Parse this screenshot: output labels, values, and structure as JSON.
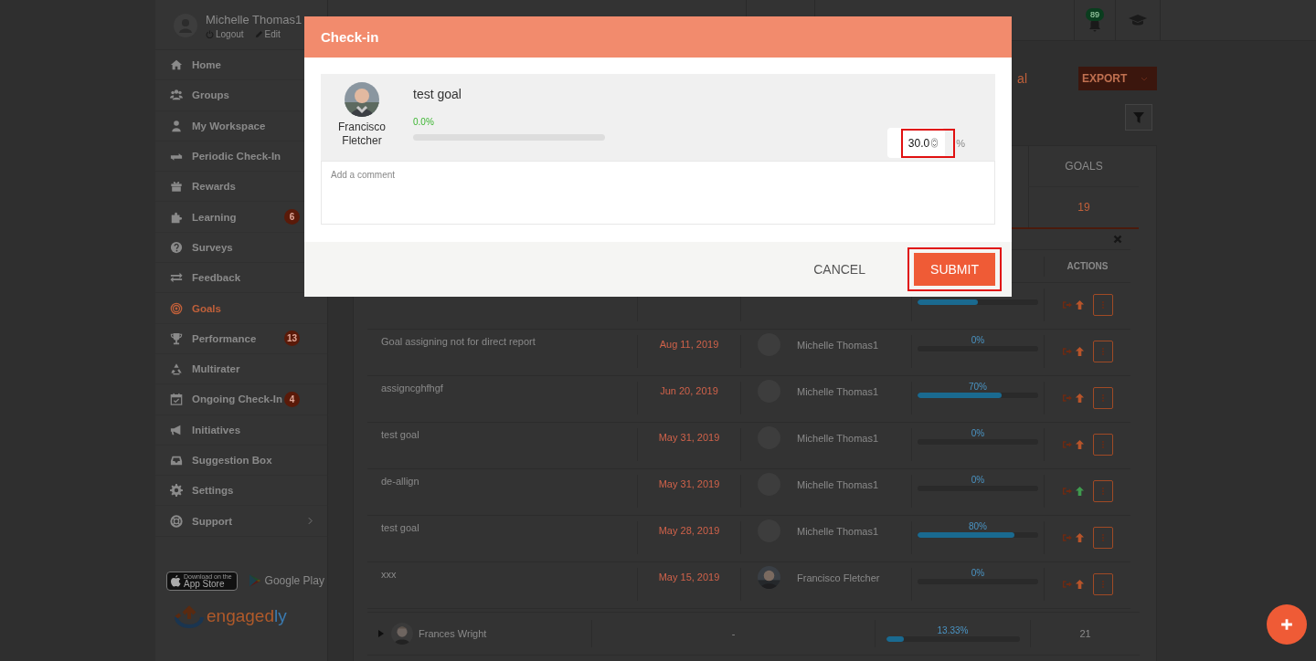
{
  "user": {
    "name": "Michelle Thomas1",
    "links": [
      {
        "label": "Logout",
        "kind": "logout"
      },
      {
        "label": "Edit",
        "kind": "edit"
      }
    ]
  },
  "notifications": {
    "badge": "89"
  },
  "sidebar": {
    "items": [
      {
        "label": "Home",
        "selected": false,
        "submenu": false
      },
      {
        "label": "Groups",
        "selected": false,
        "submenu": false
      },
      {
        "label": "My Workspace",
        "selected": false,
        "submenu": false
      },
      {
        "label": "Periodic Check-In",
        "selected": false,
        "submenu": false
      },
      {
        "label": "Rewards",
        "selected": false,
        "submenu": false
      },
      {
        "label": "Learning",
        "selected": false,
        "badge": "6",
        "submenu": false
      },
      {
        "label": "Surveys",
        "selected": false,
        "submenu": false
      },
      {
        "label": "Feedback",
        "selected": false,
        "submenu": false
      },
      {
        "label": "Goals",
        "selected": true,
        "submenu": false
      },
      {
        "label": "Performance",
        "selected": false,
        "badge": "13",
        "submenu": false
      },
      {
        "label": "Multirater",
        "selected": false,
        "submenu": false
      },
      {
        "label": "Ongoing Check-In",
        "selected": false,
        "badge": "4",
        "submenu": false
      },
      {
        "label": "Initiatives",
        "selected": false,
        "submenu": false
      },
      {
        "label": "Suggestion Box",
        "selected": false,
        "submenu": false
      },
      {
        "label": "Settings",
        "selected": false,
        "submenu": false
      },
      {
        "label": "Support",
        "selected": false,
        "submenu": true
      }
    ],
    "stores": {
      "apple_small": "Download on the",
      "apple": "App Store",
      "google": "Google Play"
    },
    "logo": {
      "text": "engaged",
      "accent": "ly"
    }
  },
  "header": {
    "title_fragment": "al",
    "export": "EXPORT"
  },
  "stats": [
    {
      "label": "GOALS",
      "value": "19"
    }
  ],
  "table": {
    "actions_heading": "ACTIONS",
    "rows": [
      {
        "level": 0.5,
        "color": "#b8542a"
      },
      {
        "title": "Goal assigning not for direct report",
        "due": "Aug 11, 2019",
        "owner": {
          "name": "Michelle Thomas1",
          "kind": "default"
        },
        "progress": "0%",
        "level": 0,
        "color": "#b8542a"
      },
      {
        "title": "assigncghfhgf",
        "due": "Jun 20, 2019",
        "owner": {
          "name": "Michelle Thomas1",
          "kind": "default"
        },
        "progress": "70%",
        "level": 0.7,
        "color": "#b8542a"
      },
      {
        "title": "test goal",
        "due": "May 31, 2019",
        "owner": {
          "name": "Michelle Thomas1",
          "kind": "default"
        },
        "progress": "0%",
        "level": 0,
        "color": "#b8542a"
      },
      {
        "title": "de-allign",
        "due": "May 31, 2019",
        "owner": {
          "name": "Michelle Thomas1",
          "kind": "default"
        },
        "progress": "0%",
        "level": 0,
        "color": "#3f9a4e"
      },
      {
        "title": "test goal",
        "due": "May 28, 2019",
        "owner": {
          "name": "Michelle Thomas1",
          "kind": "default"
        },
        "progress": "80%",
        "level": 0.8,
        "color": "#b8542a"
      },
      {
        "title": "xxx",
        "due": "May 15, 2019",
        "owner": {
          "name": "Francisco Fletcher"
        },
        "progress": "0%",
        "level": 0,
        "color": "#b8542a"
      }
    ],
    "group": {
      "name": "Frances Wright",
      "expanded": false,
      "due": "-",
      "progress": "13.33%",
      "level": 0.1333,
      "goals": "21"
    }
  },
  "modal": {
    "title": "Check-in",
    "owner": "Francisco Fletcher",
    "goal": "test goal",
    "progress": "0.0%",
    "level": 0,
    "value": "30.0",
    "value_highlighted": true,
    "unit": "%",
    "comment": {
      "placeholder": "Add a comment"
    },
    "buttons": [
      {
        "label": "CANCEL",
        "kind": "text",
        "highlighted": false
      },
      {
        "label": "SUBMIT",
        "kind": "primary",
        "highlighted": true
      }
    ]
  }
}
